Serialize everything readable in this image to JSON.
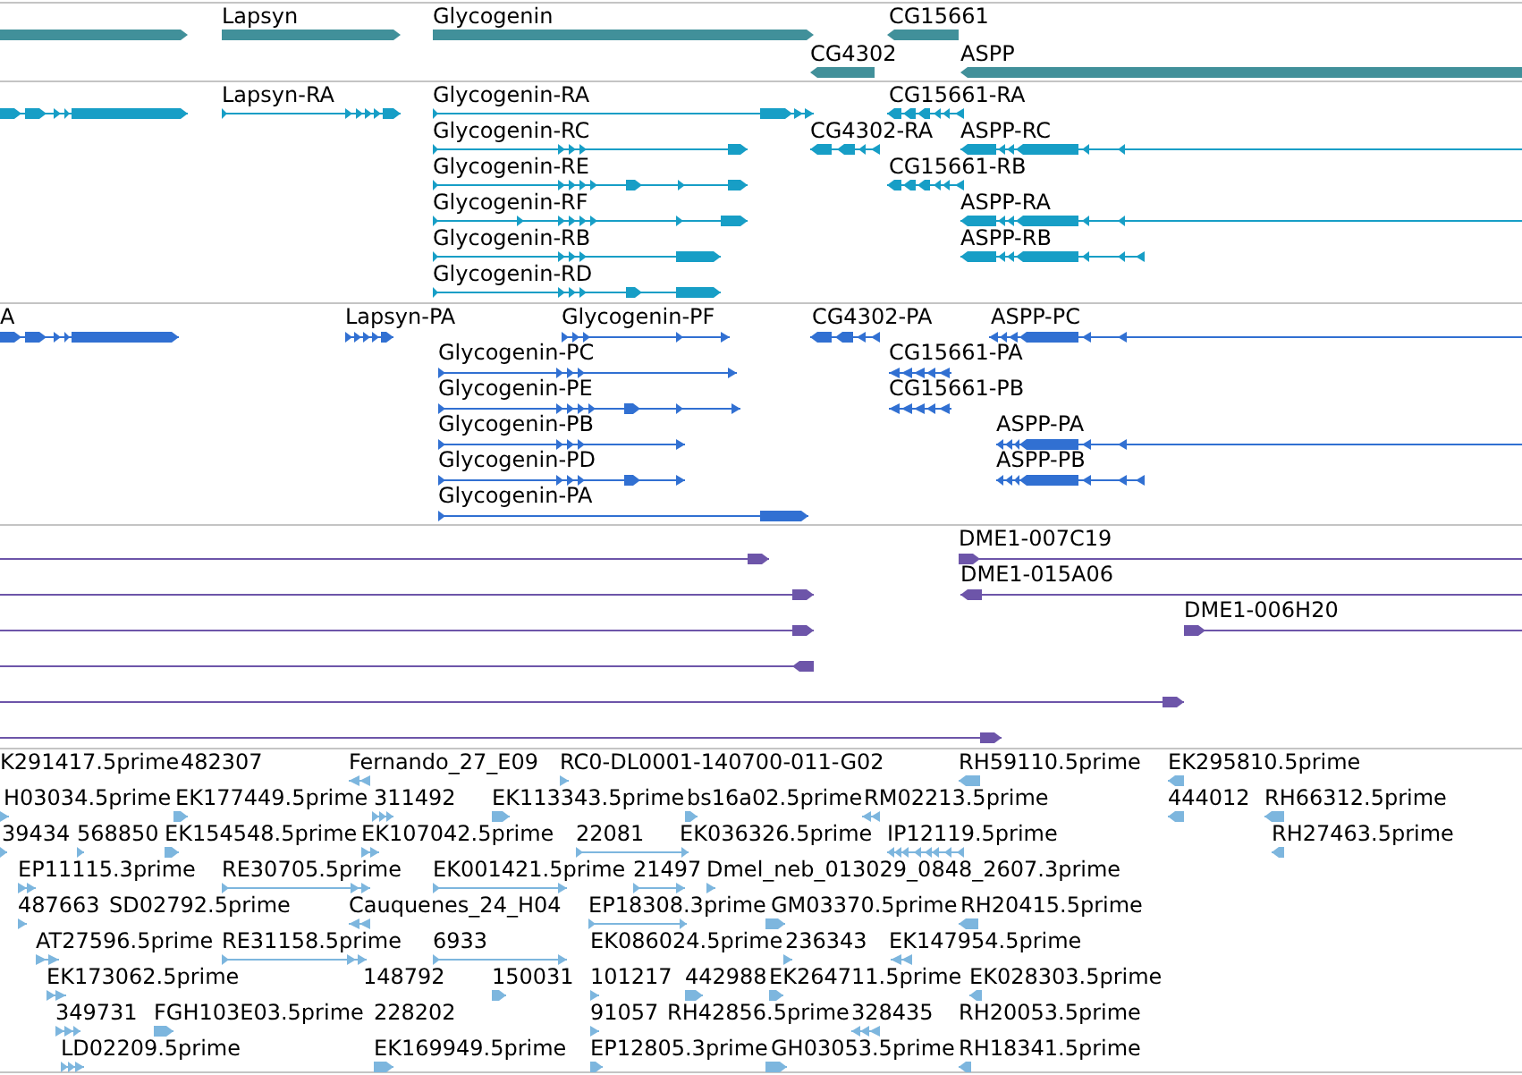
{
  "tracks": [
    {
      "kind": "gene",
      "features": [
        {
          "reverse": false
        },
        {
          "label": "Lapsyn",
          "reverse": false
        },
        {
          "label": "Glycogenin",
          "reverse": false
        },
        {
          "label": "CG15661",
          "reverse": true
        },
        {
          "label": "CG4302",
          "reverse": true
        },
        {
          "label": "ASPP",
          "reverse": true
        }
      ]
    },
    {
      "kind": "transcript",
      "features": [
        {
          "reverse": false
        },
        {
          "label": "Lapsyn-RA",
          "reverse": false
        },
        {
          "label": "Glycogenin-RA",
          "reverse": false
        },
        {
          "label": "CG15661-RA",
          "reverse": true
        },
        {
          "label": "Glycogenin-RC",
          "reverse": false
        },
        {
          "label": "CG4302-RA",
          "reverse": true
        },
        {
          "label": "ASPP-RC",
          "reverse": true
        },
        {
          "label": "Glycogenin-RE",
          "reverse": false
        },
        {
          "label": "CG15661-RB",
          "reverse": true
        },
        {
          "label": "Glycogenin-RF",
          "reverse": false
        },
        {
          "label": "ASPP-RA",
          "reverse": true
        },
        {
          "label": "Glycogenin-RB",
          "reverse": false
        },
        {
          "label": "ASPP-RB",
          "reverse": true
        },
        {
          "label": "Glycogenin-RD",
          "reverse": false
        }
      ]
    },
    {
      "kind": "protein",
      "features": [
        {
          "label": "A",
          "reverse": false
        },
        {
          "label": "Lapsyn-PA",
          "reverse": false
        },
        {
          "label": "Glycogenin-PF",
          "reverse": false
        },
        {
          "label": "CG4302-PA",
          "reverse": true
        },
        {
          "label": "ASPP-PC",
          "reverse": true
        },
        {
          "label": "Glycogenin-PC",
          "reverse": false
        },
        {
          "label": "CG15661-PA",
          "reverse": true
        },
        {
          "label": "Glycogenin-PE",
          "reverse": false
        },
        {
          "label": "CG15661-PB",
          "reverse": true
        },
        {
          "label": "Glycogenin-PB",
          "reverse": false
        },
        {
          "label": "ASPP-PA",
          "reverse": true
        },
        {
          "label": "Glycogenin-PD",
          "reverse": false
        },
        {
          "label": "ASPP-PB",
          "reverse": true
        },
        {
          "label": "Glycogenin-PA",
          "reverse": false
        }
      ]
    },
    {
      "kind": "clone",
      "features": [
        {
          "reverse": false
        },
        {
          "label": "DME1-007C19",
          "reverse": false
        },
        {
          "reverse": false
        },
        {
          "label": "DME1-015A06",
          "reverse": true
        },
        {
          "reverse": false
        },
        {
          "label": "DME1-006H20",
          "reverse": false
        },
        {
          "reverse": true
        },
        {
          "reverse": false
        },
        {
          "reverse": false
        }
      ]
    },
    {
      "kind": "est",
      "features": [
        {
          "label": "K291417.5prime"
        },
        {
          "label": "482307"
        },
        {
          "label": "Fernando_27_E09",
          "reverse": true
        },
        {
          "label": "RC0-DL0001-140700-011-G02",
          "reverse": false
        },
        {
          "label": "RH59110.5prime",
          "reverse": true
        },
        {
          "label": "EK295810.5prime",
          "reverse": true
        },
        {
          "label": "H03034.5prime",
          "reverse": false
        },
        {
          "label": "EK177449.5prime",
          "reverse": false
        },
        {
          "label": "311492",
          "reverse": false
        },
        {
          "label": "EK113343.5prime",
          "reverse": false
        },
        {
          "label": "bs16a02.5prime",
          "reverse": false
        },
        {
          "label": "RM02213.5prime",
          "reverse": true
        },
        {
          "label": "444012",
          "reverse": true
        },
        {
          "label": "RH66312.5prime",
          "reverse": true
        },
        {
          "label": "39434",
          "reverse": false
        },
        {
          "label": "568850",
          "reverse": false
        },
        {
          "label": "EK154548.5prime",
          "reverse": false
        },
        {
          "label": "EK107042.5prime",
          "reverse": false
        },
        {
          "label": "22081",
          "reverse": false
        },
        {
          "label": "EK036326.5prime"
        },
        {
          "label": "IP12119.5prime",
          "reverse": true
        },
        {
          "label": "RH27463.5prime",
          "reverse": true
        },
        {
          "label": "EP11115.3prime",
          "reverse": false
        },
        {
          "label": "RE30705.5prime",
          "reverse": false
        },
        {
          "label": "EK001421.5prime",
          "reverse": false
        },
        {
          "label": "21497",
          "reverse": false
        },
        {
          "label": "Dmel_neb_013029_0848_2607.3prime",
          "reverse": false
        },
        {
          "label": "487663",
          "reverse": false
        },
        {
          "label": "SD02792.5prime"
        },
        {
          "label": "Cauquenes_24_H04",
          "reverse": true
        },
        {
          "label": "EP18308.3prime",
          "reverse": false
        },
        {
          "label": "GM03370.5prime",
          "reverse": false
        },
        {
          "label": "RH20415.5prime",
          "reverse": true
        },
        {
          "label": "AT27596.5prime",
          "reverse": false
        },
        {
          "label": "RE31158.5prime",
          "reverse": false
        },
        {
          "label": "6933",
          "reverse": false
        },
        {
          "label": "EK086024.5prime"
        },
        {
          "label": "236343",
          "reverse": false
        },
        {
          "label": "EK147954.5prime",
          "reverse": true
        },
        {
          "label": "EK173062.5prime",
          "reverse": false
        },
        {
          "label": "148792"
        },
        {
          "label": "150031",
          "reverse": false
        },
        {
          "label": "101217",
          "reverse": false
        },
        {
          "label": "442988",
          "reverse": false
        },
        {
          "label": "EK264711.5prime",
          "reverse": false
        },
        {
          "label": "EK028303.5prime",
          "reverse": true
        },
        {
          "label": "349731",
          "reverse": false
        },
        {
          "label": "FGH103E03.5prime",
          "reverse": false
        },
        {
          "label": "228202"
        },
        {
          "label": "91057",
          "reverse": false
        },
        {
          "label": "RH42856.5prime"
        },
        {
          "label": "328435",
          "reverse": true
        },
        {
          "label": "RH20053.5prime"
        },
        {
          "label": "LD02209.5prime",
          "reverse": false
        },
        {
          "label": "EK169949.5prime",
          "reverse": false
        },
        {
          "label": "EP12805.3prime",
          "reverse": false
        },
        {
          "label": "GH03053.5prime",
          "reverse": false
        },
        {
          "label": "RH18341.5prime",
          "reverse": true
        }
      ]
    }
  ]
}
